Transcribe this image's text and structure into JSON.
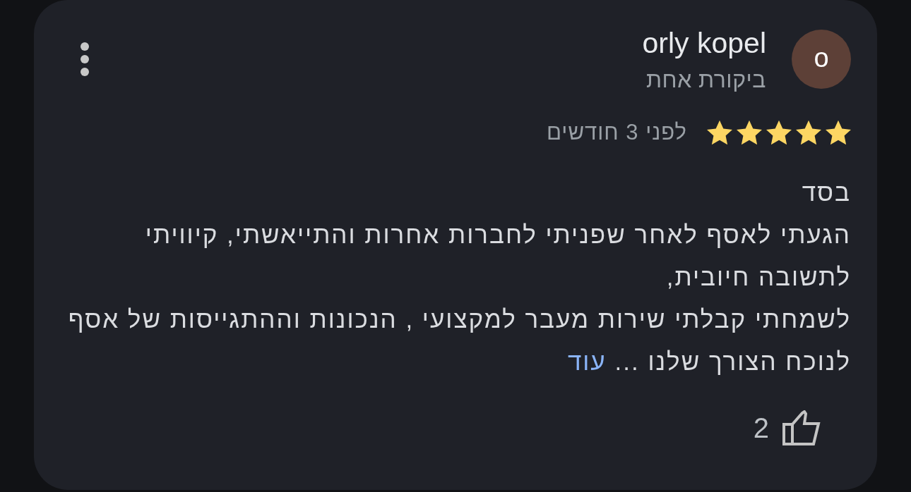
{
  "review": {
    "author": {
      "initial": "o",
      "name": "orly kopel",
      "review_count": "ביקורת אחת"
    },
    "stars": 5,
    "time": "לפני 3 חודשים",
    "text_lines": [
      "בסד",
      "הגעתי לאסף לאחר שפניתי לחברות אחרות והתייאשתי, קיוויתי",
      "לתשובה חיובית,",
      "לשמחתי קבלתי שירות מעבר למקצועי , הנכונות וההתגייסות של אסף",
      "לנוכח הצורך שלנו ..."
    ],
    "more_link": "עוד",
    "likes": "2"
  }
}
